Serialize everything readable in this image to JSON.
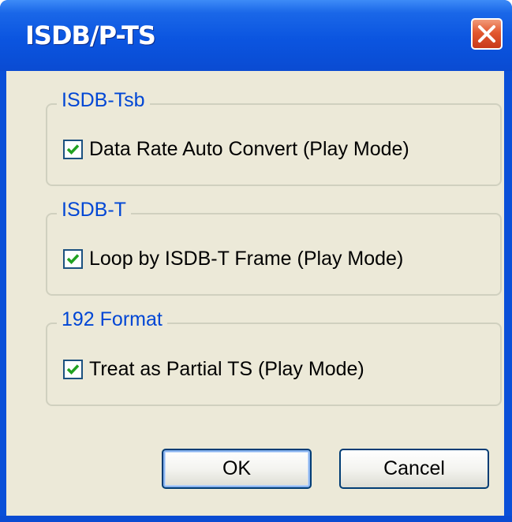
{
  "dialog": {
    "title": "ISDB/P-TS",
    "groups": [
      {
        "label": "ISDB-Tsb",
        "checkbox": {
          "label": "Data Rate Auto Convert (Play Mode)",
          "checked": true
        }
      },
      {
        "label": "ISDB-T",
        "checkbox": {
          "label": "Loop by ISDB-T Frame (Play Mode)",
          "checked": true
        }
      },
      {
        "label": "192 Format",
        "checkbox": {
          "label": "Treat as Partial TS (Play Mode)",
          "checked": true
        }
      }
    ],
    "buttons": {
      "ok": "OK",
      "cancel": "Cancel"
    }
  },
  "colors": {
    "titlebar": "#0a4fd8",
    "client_bg": "#ece9d8",
    "group_label": "#0046d5",
    "check_mark": "#21a121",
    "close_button": "#e2582f"
  },
  "icons": {
    "close": "close-icon",
    "check": "check-icon"
  }
}
